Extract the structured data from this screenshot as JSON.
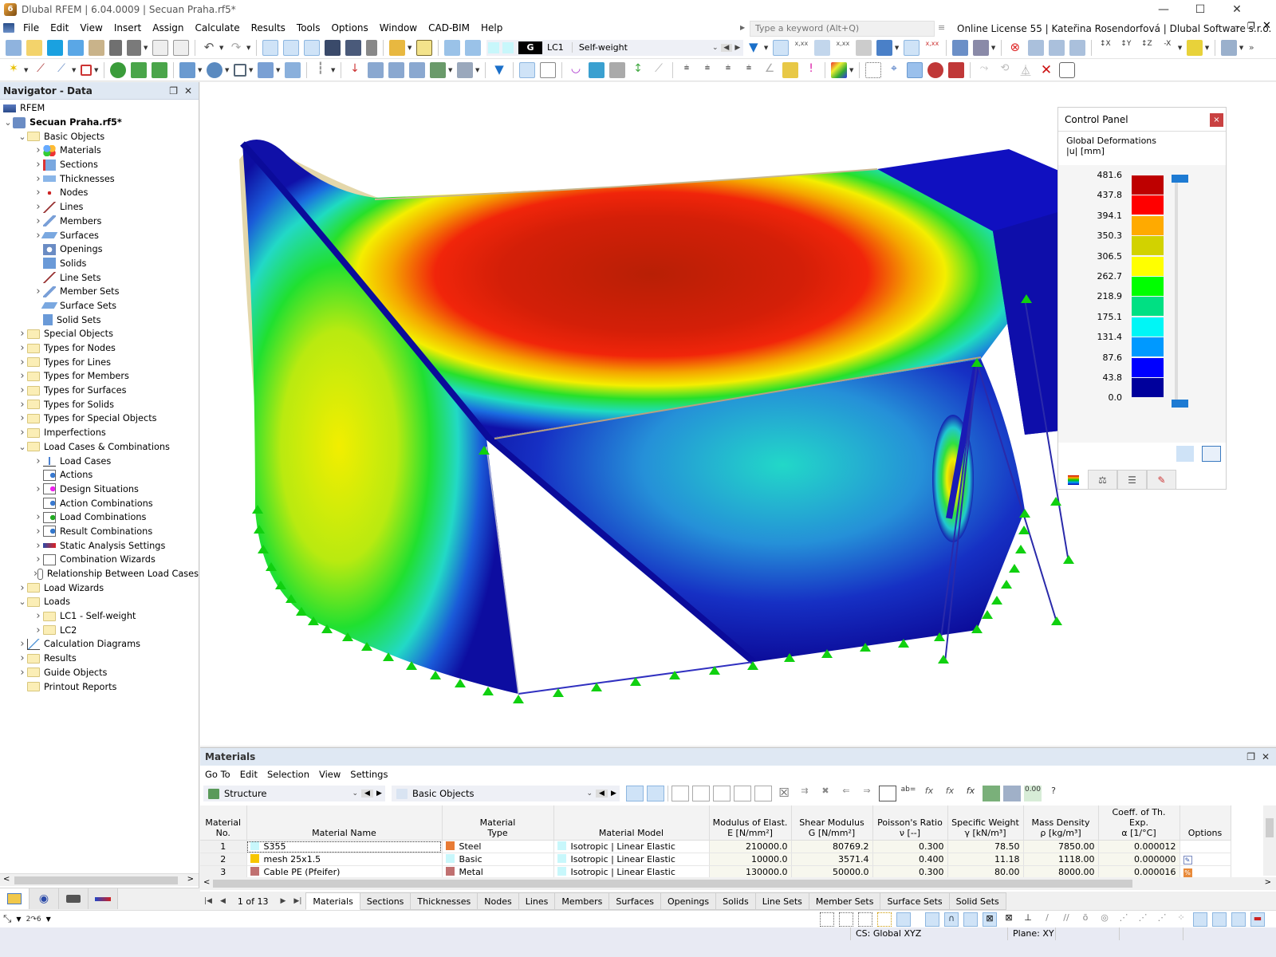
{
  "window": {
    "title": "Dlubal RFEM | 6.04.0009 | Secuan Praha.rf5*",
    "logo_glyph": "6",
    "minimize": "—",
    "maximize": "☐",
    "close": "✕"
  },
  "menu": [
    "File",
    "Edit",
    "View",
    "Insert",
    "Assign",
    "Calculate",
    "Results",
    "Tools",
    "Options",
    "Window",
    "CAD-BIM",
    "Help"
  ],
  "search": {
    "placeholder": "Type a keyword (Alt+Q)"
  },
  "license": "Online License 55 | Kateřina Rosendorfová | Dlubal Software s.r.o.",
  "load_case": {
    "group": "G",
    "id": "LC1",
    "name": "Self-weight"
  },
  "navigator": {
    "title": "Navigator - Data",
    "items": [
      {
        "label": "RFEM",
        "level": 0,
        "toggle": "",
        "icon": "rfem-icon"
      },
      {
        "label": "Secuan Praha.rf5*",
        "level": 0,
        "toggle": "v",
        "icon": "model-file-icon",
        "bold": true
      },
      {
        "label": "Basic Objects",
        "level": 1,
        "toggle": "v",
        "icon": "folder-icon"
      },
      {
        "label": "Materials",
        "level": 2,
        "toggle": ">",
        "icon": "materials-icon"
      },
      {
        "label": "Sections",
        "level": 2,
        "toggle": ">",
        "icon": "sections-icon"
      },
      {
        "label": "Thicknesses",
        "level": 2,
        "toggle": ">",
        "icon": "thicknesses-icon"
      },
      {
        "label": "Nodes",
        "level": 2,
        "toggle": ">",
        "icon": "nodes-icon"
      },
      {
        "label": "Lines",
        "level": 2,
        "toggle": ">",
        "icon": "lines-icon"
      },
      {
        "label": "Members",
        "level": 2,
        "toggle": ">",
        "icon": "members-icon"
      },
      {
        "label": "Surfaces",
        "level": 2,
        "toggle": ">",
        "icon": "surfaces-icon"
      },
      {
        "label": "Openings",
        "level": 2,
        "toggle": "",
        "icon": "openings-icon"
      },
      {
        "label": "Solids",
        "level": 2,
        "toggle": "",
        "icon": "solids-icon"
      },
      {
        "label": "Line Sets",
        "level": 2,
        "toggle": "",
        "icon": "line-sets-icon"
      },
      {
        "label": "Member Sets",
        "level": 2,
        "toggle": ">",
        "icon": "member-sets-icon"
      },
      {
        "label": "Surface Sets",
        "level": 2,
        "toggle": "",
        "icon": "surface-sets-icon"
      },
      {
        "label": "Solid Sets",
        "level": 2,
        "toggle": "",
        "icon": "solid-sets-icon"
      },
      {
        "label": "Special Objects",
        "level": 1,
        "toggle": ">",
        "icon": "folder-icon"
      },
      {
        "label": "Types for Nodes",
        "level": 1,
        "toggle": ">",
        "icon": "folder-icon"
      },
      {
        "label": "Types for Lines",
        "level": 1,
        "toggle": ">",
        "icon": "folder-icon"
      },
      {
        "label": "Types for Members",
        "level": 1,
        "toggle": ">",
        "icon": "folder-icon"
      },
      {
        "label": "Types for Surfaces",
        "level": 1,
        "toggle": ">",
        "icon": "folder-icon"
      },
      {
        "label": "Types for Solids",
        "level": 1,
        "toggle": ">",
        "icon": "folder-icon"
      },
      {
        "label": "Types for Special Objects",
        "level": 1,
        "toggle": ">",
        "icon": "folder-icon"
      },
      {
        "label": "Imperfections",
        "level": 1,
        "toggle": ">",
        "icon": "folder-icon"
      },
      {
        "label": "Load Cases & Combinations",
        "level": 1,
        "toggle": "v",
        "icon": "folder-icon"
      },
      {
        "label": "Load Cases",
        "level": 2,
        "toggle": ">",
        "icon": "load-cases-icon"
      },
      {
        "label": "Actions",
        "level": 2,
        "toggle": "",
        "icon": "actions-icon"
      },
      {
        "label": "Design Situations",
        "level": 2,
        "toggle": ">",
        "icon": "design-situations-icon"
      },
      {
        "label": "Action Combinations",
        "level": 2,
        "toggle": "",
        "icon": "action-combinations-icon"
      },
      {
        "label": "Load Combinations",
        "level": 2,
        "toggle": ">",
        "icon": "load-combinations-icon"
      },
      {
        "label": "Result Combinations",
        "level": 2,
        "toggle": ">",
        "icon": "result-combinations-icon"
      },
      {
        "label": "Static Analysis Settings",
        "level": 2,
        "toggle": ">",
        "icon": "static-analysis-icon"
      },
      {
        "label": "Combination Wizards",
        "level": 2,
        "toggle": ">",
        "icon": "combination-wizards-icon"
      },
      {
        "label": "Relationship Between Load Cases",
        "level": 2,
        "toggle": ">",
        "icon": "relationship-icon"
      },
      {
        "label": "Load Wizards",
        "level": 1,
        "toggle": ">",
        "icon": "folder-icon"
      },
      {
        "label": "Loads",
        "level": 1,
        "toggle": "v",
        "icon": "folder-icon"
      },
      {
        "label": "LC1 - Self-weight",
        "level": 2,
        "toggle": ">",
        "icon": "folder-icon"
      },
      {
        "label": "LC2",
        "level": 2,
        "toggle": ">",
        "icon": "folder-icon"
      },
      {
        "label": "Calculation Diagrams",
        "level": 1,
        "toggle": ">",
        "icon": "calculation-diagrams-icon"
      },
      {
        "label": "Results",
        "level": 1,
        "toggle": ">",
        "icon": "folder-icon"
      },
      {
        "label": "Guide Objects",
        "level": 1,
        "toggle": ">",
        "icon": "folder-icon"
      },
      {
        "label": "Printout Reports",
        "level": 1,
        "toggle": "",
        "icon": "folder-icon"
      }
    ],
    "tabs": [
      "data-icon",
      "view-icon",
      "camera-icon",
      "result-icon"
    ]
  },
  "control_panel": {
    "title": "Control Panel",
    "close": "×",
    "result_title": "Global Deformations",
    "result_unit": "|u| [mm]",
    "scale_values": [
      "481.6",
      "437.8",
      "394.1",
      "350.3",
      "306.5",
      "262.7",
      "218.9",
      "175.1",
      "131.4",
      "87.6",
      "43.8",
      "0.0"
    ],
    "scale_colors": [
      "#be0000",
      "#ff0000",
      "#ffaa00",
      "#d2d200",
      "#ffff00",
      "#00ff00",
      "#00e083",
      "#00f6f6",
      "#0099ff",
      "#0000ff",
      "#00009c"
    ],
    "tabs": [
      "color-scale-icon",
      "balance-icon",
      "list-icon",
      "pointer-icon"
    ]
  },
  "table_panel": {
    "title": "Materials",
    "menu": [
      "Go To",
      "Edit",
      "Selection",
      "View",
      "Settings"
    ],
    "combo_left": "Structure",
    "combo_right": "Basic Objects",
    "headers": [
      [
        "Material",
        "No."
      ],
      [
        "",
        "Material Name"
      ],
      [
        "Material",
        "Type"
      ],
      [
        "",
        "Material Model"
      ],
      [
        "Modulus of Elast.",
        "E [N/mm²]"
      ],
      [
        "Shear Modulus",
        "G [N/mm²]"
      ],
      [
        "Poisson's Ratio",
        "ν [--]"
      ],
      [
        "Specific Weight",
        "γ [kN/m³]"
      ],
      [
        "Mass Density",
        "ρ [kg/m³]"
      ],
      [
        "Coeff. of Th. Exp.",
        "α [1/°C]"
      ],
      [
        "",
        "Options"
      ]
    ],
    "rows": [
      {
        "no": "1",
        "name": "S355",
        "name_color": "#c8f7fb",
        "type": "Steel",
        "type_color": "#e87b35",
        "model": "Isotropic | Linear Elastic",
        "E": "210000.0",
        "G": "80769.2",
        "nu": "0.300",
        "gamma": "78.50",
        "rho": "7850.00",
        "alpha": "0.000012",
        "option": ""
      },
      {
        "no": "2",
        "name": "mesh 25x1.5",
        "name_color": "#f7c600",
        "type": "Basic",
        "type_color": "#c8f7fb",
        "model": "Isotropic | Linear Elastic",
        "E": "10000.0",
        "G": "3571.4",
        "nu": "0.400",
        "gamma": "11.18",
        "rho": "1118.00",
        "alpha": "0.000000",
        "option": "edit-icon"
      },
      {
        "no": "3",
        "name": "Cable PE (Pfeifer)",
        "name_color": "#c07070",
        "type": "Metal",
        "type_color": "#c07070",
        "model": "Isotropic | Linear Elastic",
        "E": "130000.0",
        "G": "50000.0",
        "nu": "0.300",
        "gamma": "80.00",
        "rho": "8000.00",
        "alpha": "0.000016",
        "option": "percent-icon"
      }
    ],
    "pager": "1 of 13",
    "sheet_tabs": [
      "Materials",
      "Sections",
      "Thicknesses",
      "Nodes",
      "Lines",
      "Members",
      "Surfaces",
      "Openings",
      "Solids",
      "Line Sets",
      "Member Sets",
      "Surface Sets",
      "Solid Sets"
    ],
    "active_sheet": "Materials"
  },
  "status": {
    "cs": "CS: Global XYZ",
    "plane": "Plane: XY"
  }
}
